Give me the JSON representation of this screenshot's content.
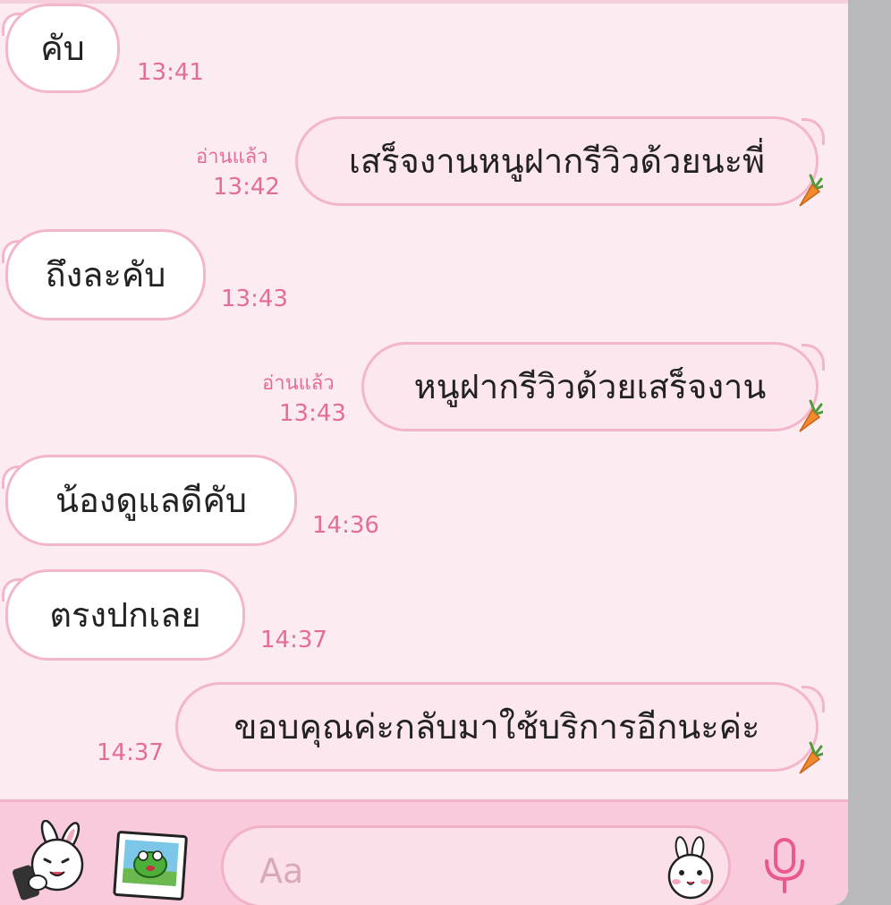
{
  "read_label": "อ่านแล้ว",
  "messages": [
    {
      "side": "in",
      "text": "คับ",
      "time": "13:41"
    },
    {
      "side": "out",
      "text": "เสร็จงานหนูฝากรีวิวด้วยนะพี่",
      "time": "13:42",
      "read": true
    },
    {
      "side": "in",
      "text": "ถึงละคับ",
      "time": "13:43"
    },
    {
      "side": "out",
      "text": "หนูฝากรีวิวด้วยเสร็จงาน",
      "time": "13:43",
      "read": true
    },
    {
      "side": "in",
      "text": "น้องดูแลดีคับ",
      "time": "14:36"
    },
    {
      "side": "in",
      "text": "ตรงปกเลย",
      "time": "14:37"
    },
    {
      "side": "out",
      "text": "ขอบคุณค่ะกลับมาใช้บริการอีกนะค่ะ",
      "time": "14:37",
      "read": false
    }
  ],
  "input": {
    "placeholder": "Aa"
  },
  "icons": {
    "sticker_button": "bunny-sticker-icon",
    "photo_button": "photo-icon",
    "emoji_button": "bunny-emoji-icon",
    "mic_button": "microphone-icon",
    "bubble_decoration": "carrot-icon"
  },
  "colors": {
    "background": "#fcecf2",
    "bubble_out": "#fde7ef",
    "bubble_border": "#f3b6c9",
    "time_text": "#e46d97",
    "input_bar": "#f8cadb"
  }
}
